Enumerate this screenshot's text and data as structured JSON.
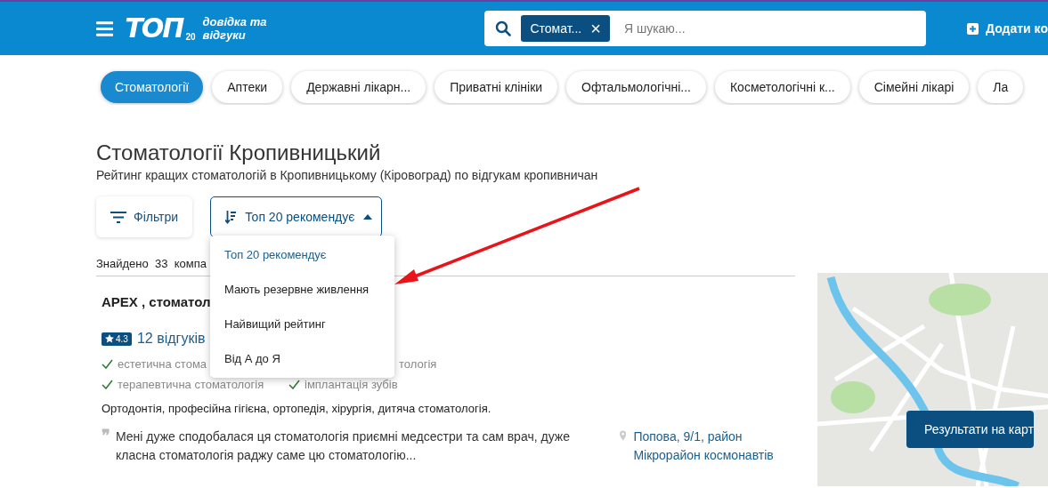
{
  "header": {
    "logo_text": "ТОП",
    "logo_number": "20",
    "tagline": [
      "довідка та",
      "відгуки"
    ],
    "search": {
      "chip": "Стомат...",
      "chip_remove": "×",
      "placeholder": "Я шукаю..."
    },
    "add_button": "Додати ко"
  },
  "categories": [
    {
      "label": "Стоматології",
      "selected": true
    },
    {
      "label": "Аптеки",
      "selected": false
    },
    {
      "label": "Державні лікарн...",
      "selected": false
    },
    {
      "label": "Приватні клініки",
      "selected": false
    },
    {
      "label": "Офтальмологічні...",
      "selected": false
    },
    {
      "label": "Косметологічні к...",
      "selected": false
    },
    {
      "label": "Сімейні лікарі",
      "selected": false
    },
    {
      "label": "Ла",
      "selected": false
    }
  ],
  "title": "Стоматології Кропивницький",
  "subtitle": "Рейтинг кращих стоматологій в Кропивницькому (Кіровоград) по відгукам кропивничан",
  "filters_button": "Фільтри",
  "sort": {
    "label": "Топ 20 рекомендує",
    "expanded": true,
    "options": [
      {
        "label": "Топ 20 рекомендує",
        "selected": true
      },
      {
        "label": "Мають резервне живлення",
        "selected": false
      },
      {
        "label": "Найвищий рейтинг",
        "selected": false
      },
      {
        "label": "Від А до Я",
        "selected": false
      }
    ]
  },
  "found": "Знайдено  33  компа",
  "listing": {
    "name": "APEX , стоматол",
    "rating": "4.3",
    "reviews": "12 відгуків",
    "tag_rows": [
      [
        {
          "text": "естетична стома",
          "checked": true
        },
        {
          "text": "тологія",
          "checked": false
        }
      ],
      [
        {
          "text": "терапевтична стоматологія",
          "checked": true
        },
        {
          "text": "імплантація зубів",
          "checked": true
        }
      ]
    ],
    "services": "Ортодонтія, професійна гігієна, ортопедія, хірургія, дитяча стоматологія.",
    "quote_mark": "❞",
    "quote": "Мені дуже сподобалася ця стоматологія приємні медсестри та сам врач, дуже класна стоматологія раджу саме цю стоматологію...",
    "address": "Попова, 9/1, район Мікрорайон космонавтів"
  },
  "map": {
    "button": "Результати на карт"
  }
}
